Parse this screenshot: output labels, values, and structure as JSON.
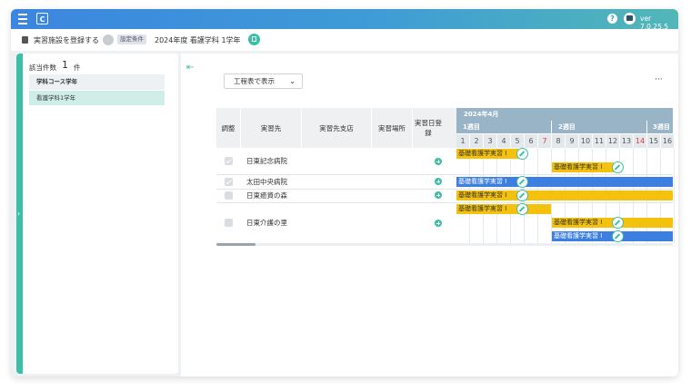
{
  "header": {
    "version": "ver 7.0.25.5",
    "help_glyph": "?",
    "logo_glyph": "C"
  },
  "subheader": {
    "title": "実習施設を登録する",
    "condition_badge": "設定条件",
    "condition": "2024年度  看護学科  1学年"
  },
  "left_panel": {
    "count_label": "該当件数",
    "count": "1",
    "count_unit": "件",
    "list_header": "学科コース学年",
    "items": [
      "看護学科1学年"
    ]
  },
  "toolbar": {
    "view_select": "工程表で表示",
    "more": "···"
  },
  "table": {
    "headers": [
      "調整",
      "実習先",
      "実習先支店",
      "実習場所",
      "実習日登録"
    ],
    "rows": [
      {
        "adjust_checked": true,
        "name": "日東記念病院"
      },
      {
        "adjust_checked": true,
        "name": "太田中央病院"
      },
      {
        "adjust_checked": false,
        "name": "日東癒資の森"
      },
      {
        "adjust_checked": false,
        "name": "日東介護の里"
      }
    ]
  },
  "gantt": {
    "month": "2024年4月",
    "weeks": [
      "1週目",
      "2週目",
      "3週目"
    ],
    "days": [
      "1",
      "2",
      "3",
      "4",
      "5",
      "6",
      "7",
      "8",
      "9",
      "10",
      "11",
      "12",
      "13",
      "14",
      "15",
      "16"
    ],
    "bar_label": "基礎看護学実習 I",
    "colors": {
      "yellow": "#f4c20d",
      "blue": "#3d7fe0",
      "accent": "#3cbfa6"
    }
  }
}
